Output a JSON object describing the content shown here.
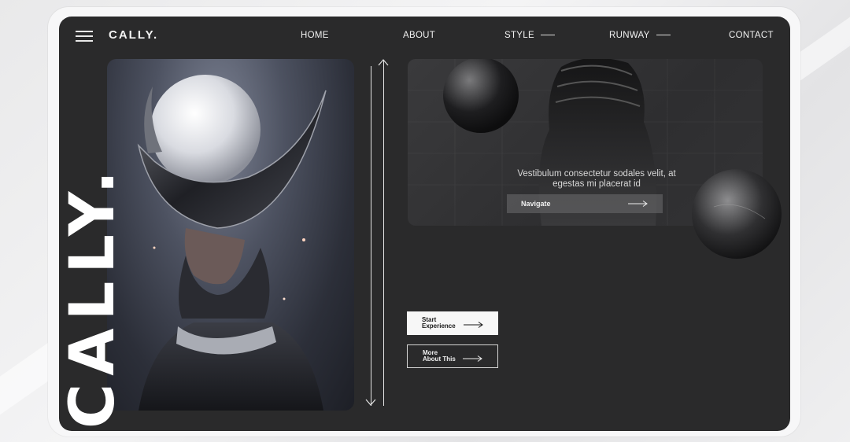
{
  "brand": {
    "logo": "CALLY.",
    "vertical_logo": "CALLY."
  },
  "nav": {
    "items": [
      {
        "label": "HOME"
      },
      {
        "label": "ABOUT"
      },
      {
        "label": "STYLE"
      },
      {
        "label": "RUNWAY"
      },
      {
        "label": "CONTACT"
      }
    ]
  },
  "hero": {
    "text": "Vestibulum consectetur sodales velit, at egestas mi placerat id",
    "navigate_label": "Navigate"
  },
  "cta": {
    "start": "Start\nExperience",
    "more": "More\nAbout This"
  },
  "icons": {
    "menu": "hamburger-icon",
    "arrow": "arrow-right-icon",
    "scroll": "double-arrow-vertical-icon"
  },
  "colors": {
    "screen_bg": "#2a2a2b",
    "text": "#f0f0f0",
    "frame": "#f7f7f8"
  }
}
